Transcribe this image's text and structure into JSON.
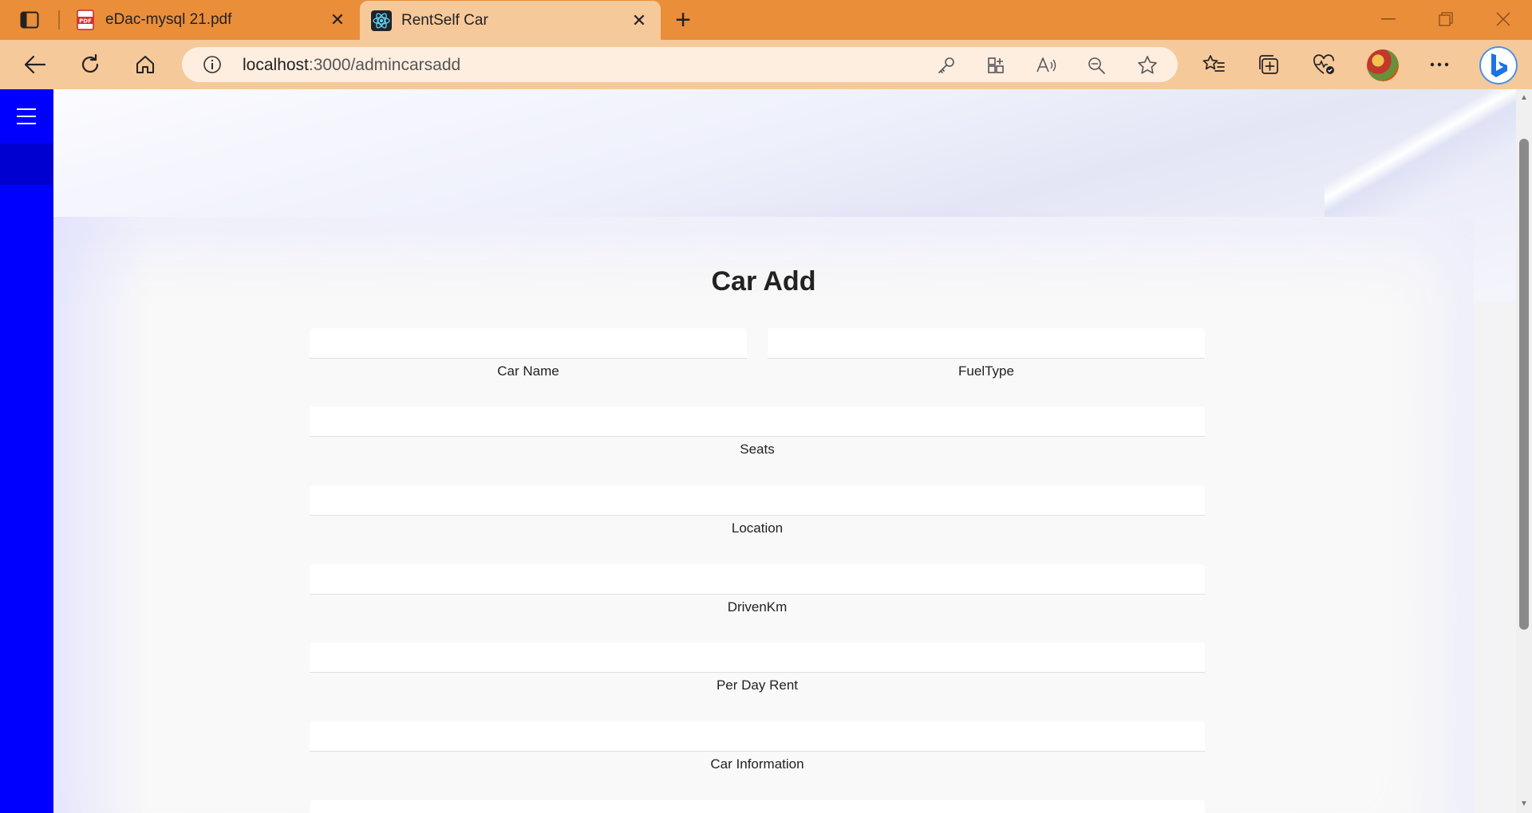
{
  "browser": {
    "tabs": [
      {
        "title": "eDac-mysql 21.pdf",
        "icon": "pdf-icon",
        "active": false
      },
      {
        "title": "RentSelf Car",
        "icon": "react-icon",
        "active": true
      }
    ],
    "address": {
      "host": "localhost",
      "path": ":3000/admincarsadd"
    },
    "accent": "#ea8e3a"
  },
  "sidebar": {
    "color": "#0000ff"
  },
  "form": {
    "title": "Car Add",
    "fields": {
      "car_name": {
        "label": "Car Name",
        "value": ""
      },
      "fuel_type": {
        "label": "FuelType",
        "value": ""
      },
      "seats": {
        "label": "Seats",
        "value": ""
      },
      "location": {
        "label": "Location",
        "value": ""
      },
      "driven_km": {
        "label": "DrivenKm",
        "value": ""
      },
      "per_day_rent": {
        "label": "Per Day Rent",
        "value": ""
      },
      "car_information": {
        "label": "Car Information",
        "value": ""
      }
    }
  }
}
